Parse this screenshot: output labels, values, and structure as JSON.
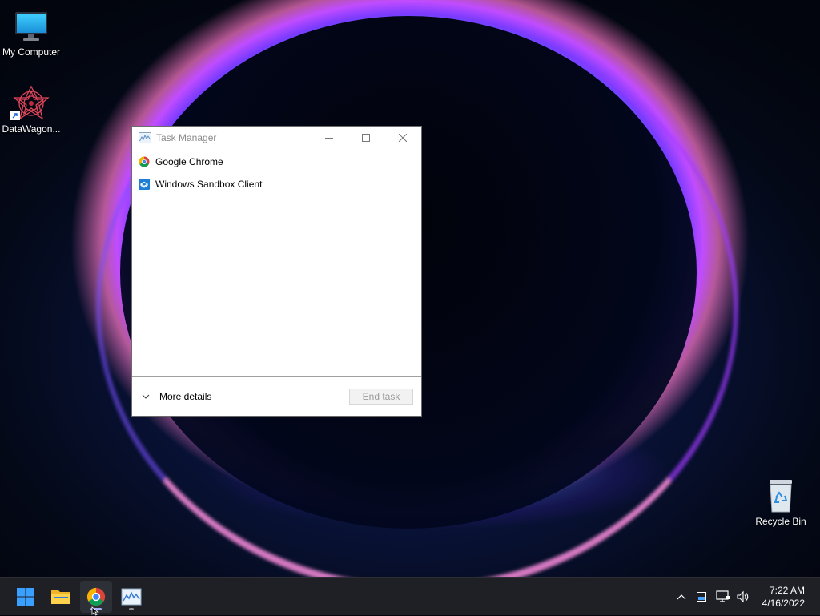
{
  "desktop": {
    "icons": [
      {
        "label": "My Computer",
        "icon": "monitor-icon"
      },
      {
        "label": "DataWagon...",
        "icon": "datawagon-app-icon"
      },
      {
        "label": "Recycle Bin",
        "icon": "recycle-bin-icon"
      }
    ]
  },
  "task_manager": {
    "title": "Task Manager",
    "apps": [
      {
        "name": "Google Chrome",
        "icon": "chrome-icon"
      },
      {
        "name": "Windows Sandbox Client",
        "icon": "sandbox-icon"
      }
    ],
    "more_details_label": "More details",
    "end_task_label": "End task"
  },
  "taskbar": {
    "apps": [
      "start-icon",
      "file-explorer-icon",
      "chrome-icon",
      "task-manager-icon"
    ],
    "tray": [
      "chevron-up-icon",
      "tablet-icon",
      "network-icon",
      "volume-icon"
    ],
    "time": "7:22 AM",
    "date": "4/16/2022"
  },
  "colors": {
    "taskbar_bg": "#1e2025",
    "window_border": "#6b6b6b",
    "start_blue": "#3aa0ff"
  }
}
